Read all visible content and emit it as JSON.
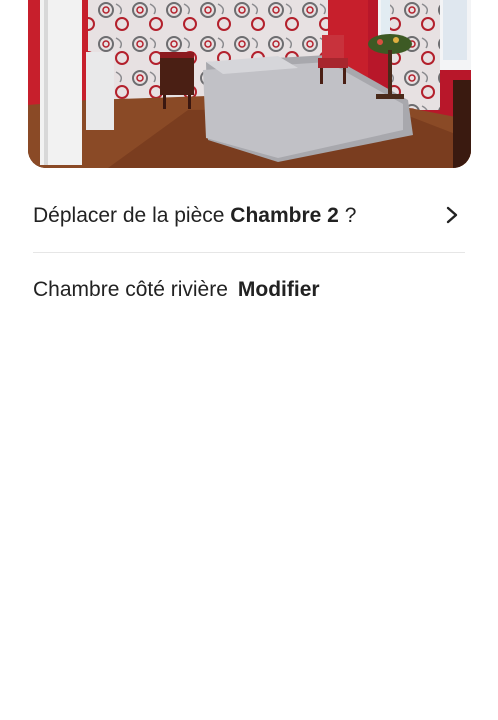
{
  "photo": {
    "name": "room-photo"
  },
  "move_room": {
    "prefix": "Déplacer de la pièce",
    "room": "Chambre 2",
    "suffix": "?",
    "icon": "chevron-right-icon"
  },
  "photo_caption": {
    "text": "Chambre côté rivière",
    "edit_label": "Modifier"
  }
}
